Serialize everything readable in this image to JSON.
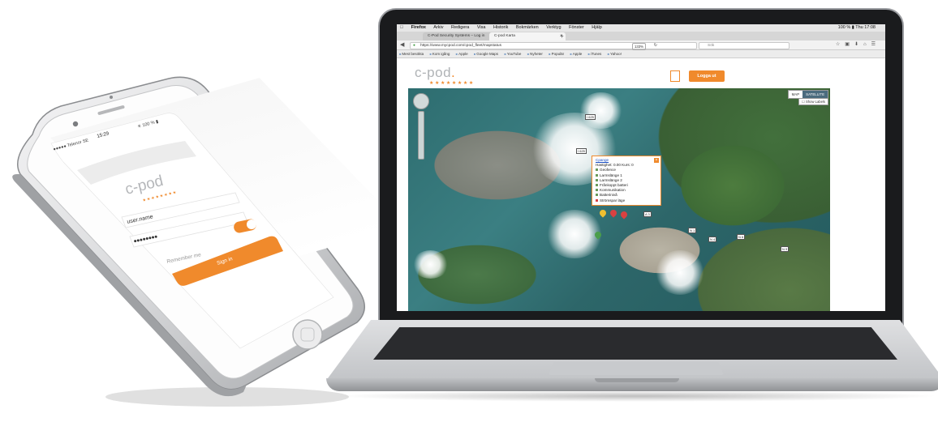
{
  "mac_menubar": {
    "apple": "",
    "app": "Firefox",
    "items": [
      "Arkiv",
      "Redigera",
      "Visa",
      "Historik",
      "Bokmärken",
      "Verktyg",
      "Fönster",
      "Hjälp"
    ],
    "right": "100 % ▮ Thu 17:08"
  },
  "browser": {
    "tabs": [
      "C-Pod Security Systems – Log in",
      "C-pod Karta"
    ],
    "new_tab": "+",
    "url": "https://www.mycpod.com/cpod_fleet/mapstatus",
    "url_prefix": "https://www.",
    "zoom": "133%",
    "search_placeholder": "Sök",
    "bookmarks": [
      "Mest besökta",
      "Kom igång",
      "Apple",
      "Google Maps",
      "YouTube",
      "Nyheter",
      "Populär",
      "Apple",
      "iTunes",
      "Yahoo!"
    ]
  },
  "site": {
    "logo": "c-pod",
    "logo_dot": ".",
    "stars": "★★★★★★★★",
    "login_button": "Logga ut"
  },
  "map": {
    "type_map": "MAP",
    "type_satellite": "SATELLITE",
    "show_labels": "Show Labels",
    "highway_labels": [
      "I 625",
      "I 625",
      "A 3",
      "N 1",
      "N 4",
      "N 6",
      "N 9"
    ],
    "popup": {
      "title": "Cpange",
      "speed_line": "Hastighet: 0.00 Kurs: 0",
      "rows": [
        {
          "label": "Geofence",
          "color": "#4a9e4a"
        },
        {
          "label": "Larmslänge 1",
          "color": "#4a9e4a"
        },
        {
          "label": "Larmslänge 2",
          "color": "#4a9e4a"
        },
        {
          "label": "Frånkoppt batteri",
          "color": "#4a9e4a"
        },
        {
          "label": "Kommunikation",
          "color": "#4a9e4a"
        },
        {
          "label": "Batterinivå",
          "color": "#4a9e4a"
        },
        {
          "label": "Strömspar läge",
          "color": "#d94141"
        }
      ],
      "close": "×"
    }
  },
  "phone": {
    "status_left": "●●●●● Telenor SE",
    "status_time": "15:29",
    "status_right": "✳ 100 % ▮",
    "logo": "c-pod",
    "stars": "★★★★★★★★",
    "username": "user.name",
    "password": "●●●●●●●●",
    "remember": "Remember me",
    "remember_on": true,
    "sign_in": "Sign in"
  }
}
